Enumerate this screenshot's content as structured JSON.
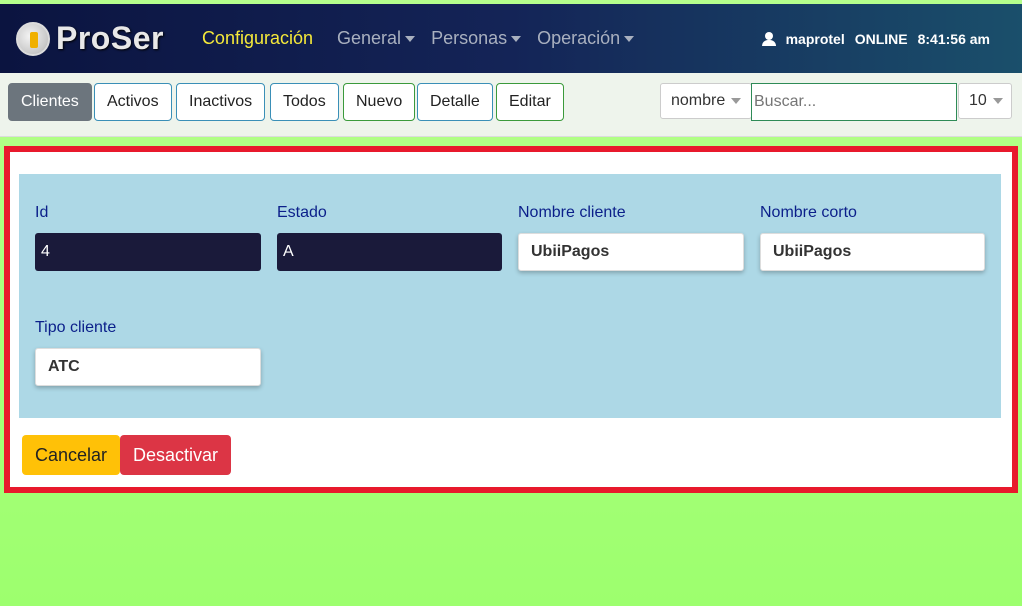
{
  "app": {
    "logo_text": "ProSer",
    "nav": [
      {
        "label": "Configuración"
      },
      {
        "label": "General"
      },
      {
        "label": "Personas"
      },
      {
        "label": "Operación"
      }
    ],
    "user": {
      "name": "maprotel",
      "status": "ONLINE",
      "time": "8:41:56 am"
    }
  },
  "toolbar": {
    "buttons": [
      {
        "label": "Clientes"
      },
      {
        "label": "Activos"
      },
      {
        "label": "Inactivos"
      },
      {
        "label": "Todos"
      },
      {
        "label": "Nuevo"
      },
      {
        "label": "Detalle"
      },
      {
        "label": "Editar"
      }
    ],
    "field_select": "nombre",
    "search_placeholder": "Buscar...",
    "page_size": "10"
  },
  "form": {
    "id": {
      "label": "Id",
      "value": "4"
    },
    "estado": {
      "label": "Estado",
      "value": "A"
    },
    "nombre_cliente": {
      "label": "Nombre cliente",
      "value": "UbiiPagos"
    },
    "nombre_corto": {
      "label": "Nombre corto",
      "value": "UbiiPagos"
    },
    "tipo_cliente": {
      "label": "Tipo cliente",
      "value": "ATC"
    },
    "cancel_label": "Cancelar",
    "deactivate_label": "Desactivar"
  },
  "colors": {
    "highlight_border": "#e8192c",
    "form_bg": "#add8e6",
    "active_nav": "#f5e93a",
    "page_bg": "#9dff6e"
  }
}
